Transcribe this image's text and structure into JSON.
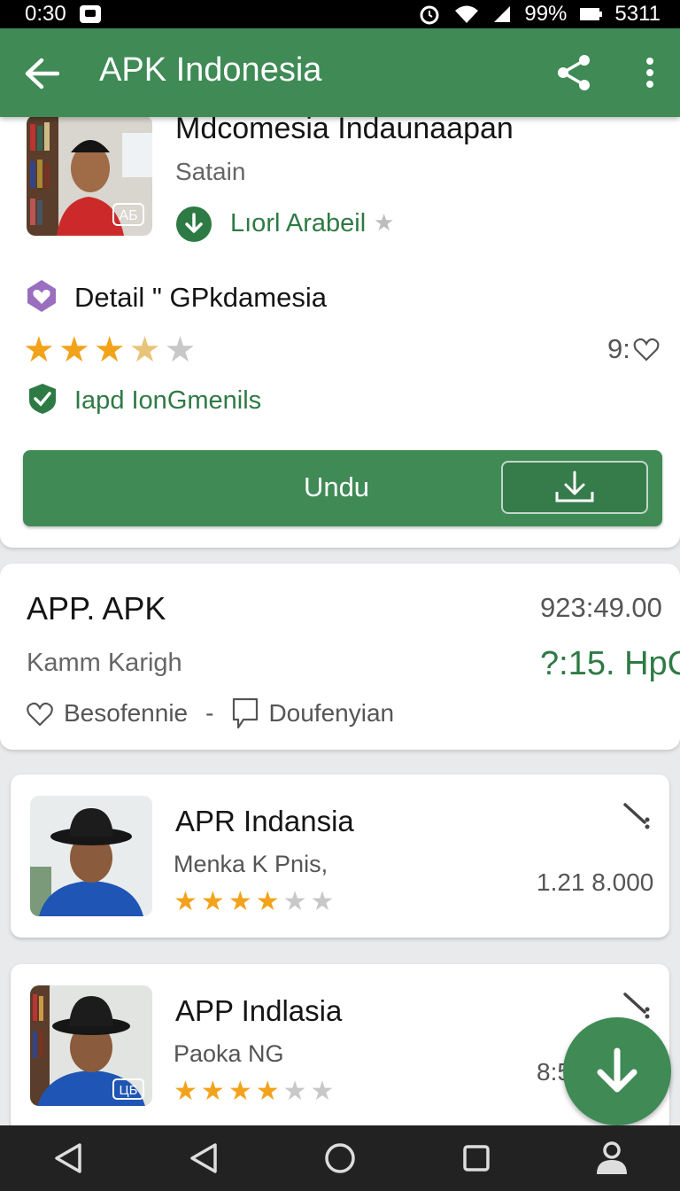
{
  "status_bar": {
    "time": "0:30",
    "battery": "99%",
    "signal_text": "5311"
  },
  "app_bar": {
    "title": "APK Indonesia"
  },
  "featured": {
    "title": "Mdcomesia Indaunaapan",
    "subtitle": "Satain",
    "download_label": "Lıorl Arabeil",
    "avatar_badge": "AБ",
    "detail_title": "Detail \" GPkdamesia",
    "rating": 3.5,
    "favorites": "9:",
    "verified_label": "Iapd IonGmenils",
    "button_label": "Undu"
  },
  "app_info": {
    "title": "APP. APK",
    "price": "923:49.00",
    "subtitle": "Kamm Karigh",
    "green_value": "?:15. HpC",
    "action_favorite": "Besofennie",
    "separator": "-",
    "action_comment": "Doufenyian"
  },
  "list": [
    {
      "title": "APR Indansia",
      "subtitle": "Menka K Pnis,",
      "rating": 4,
      "value": "1.21 8.000"
    },
    {
      "title": "APP Indlasia",
      "subtitle": "Paoka NG",
      "rating": 4,
      "value": "8:5",
      "avatar_badge": "ЦБ"
    }
  ],
  "colors": {
    "primary": "#3f8a55",
    "accent_green_text": "#2e7a45",
    "star": "#f2a31b",
    "star_empty": "#c8c8c8",
    "detail_icon": "#9b6fc0"
  }
}
